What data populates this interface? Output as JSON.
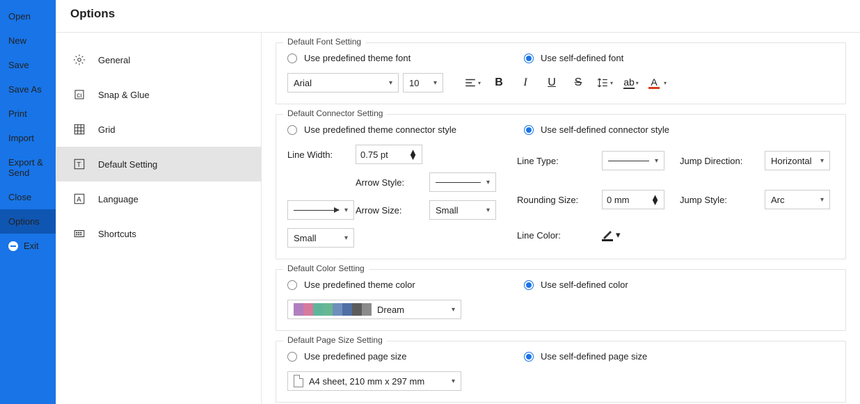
{
  "filemenu": {
    "items": [
      {
        "label": "Open"
      },
      {
        "label": "New"
      },
      {
        "label": "Save"
      },
      {
        "label": "Save As"
      },
      {
        "label": "Print"
      },
      {
        "label": "Import"
      },
      {
        "label": "Export & Send"
      },
      {
        "label": "Close"
      },
      {
        "label": "Options"
      },
      {
        "label": "Exit"
      }
    ]
  },
  "title": "Options",
  "categories": {
    "items": [
      {
        "label": "General"
      },
      {
        "label": "Snap & Glue"
      },
      {
        "label": "Grid"
      },
      {
        "label": "Default Setting"
      },
      {
        "label": "Language"
      },
      {
        "label": "Shortcuts"
      }
    ]
  },
  "font_group": {
    "legend": "Default Font Setting",
    "radio_theme": "Use predefined theme font",
    "radio_self": "Use self-defined font",
    "font": "Arial",
    "size": "10"
  },
  "conn_group": {
    "legend": "Default Connector Setting",
    "radio_theme": "Use predefined theme connector style",
    "radio_self": "Use self-defined connector style",
    "labels": {
      "line_width": "Line Width:",
      "arrow_style": "Arrow Style:",
      "arrow_size": "Arrow Size:",
      "line_type": "Line Type:",
      "jump_dir": "Jump Direction:",
      "rounding": "Rounding Size:",
      "jump_style": "Jump Style:",
      "line_color": "Line Color:"
    },
    "values": {
      "line_width": "0.75 pt",
      "arrow_size_start": "Small",
      "arrow_size_end": "Small",
      "rounding": "0 mm",
      "jump_dir": "Horizontal",
      "jump_style": "Arc"
    }
  },
  "color_group": {
    "legend": "Default Color Setting",
    "radio_theme": "Use predefined theme color",
    "radio_self": "Use self-defined color",
    "palette_name": "Dream",
    "swatches": [
      "#b07fbf",
      "#d77a9e",
      "#5fb59a",
      "#67b892",
      "#6e8fbc",
      "#4f6fa5",
      "#5c5c5c",
      "#8b8b8b"
    ]
  },
  "page_group": {
    "legend": "Default Page Size Setting",
    "radio_theme": "Use predefined page size",
    "radio_self": "Use self-defined page size",
    "page_size": "A4 sheet, 210 mm x 297 mm"
  },
  "colors": {
    "font_underline": "#d83b1c",
    "line_color": "#222"
  }
}
